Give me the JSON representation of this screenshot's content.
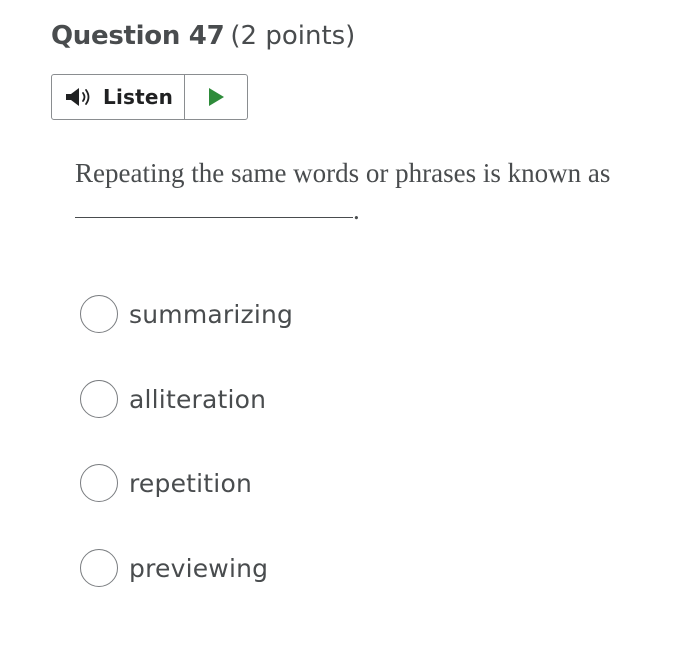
{
  "question": {
    "title": "Question 47",
    "points": "(2 points)",
    "text": "Repeating the same words or phrases is known as",
    "blank_suffix": "."
  },
  "listen": {
    "label": "Listen",
    "speaker_icon": "speaker-icon",
    "play_icon": "play-icon",
    "play_color": "#2e8b3a"
  },
  "options": [
    {
      "label": "summarizing",
      "selected": false
    },
    {
      "label": "alliteration",
      "selected": false
    },
    {
      "label": "repetition",
      "selected": false
    },
    {
      "label": "previewing",
      "selected": false
    }
  ]
}
